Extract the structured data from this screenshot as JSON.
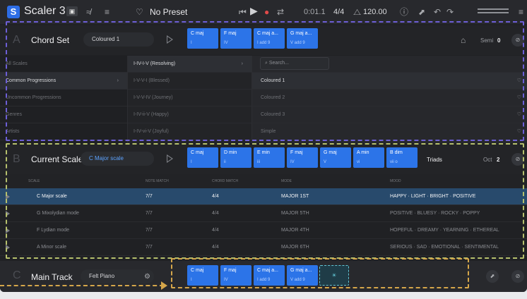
{
  "app": {
    "logo": "S",
    "title": "Scaler 3"
  },
  "topbar": {
    "preset": "No Preset",
    "position": "0:01.1",
    "time_signature": "4/4",
    "tempo": "120.00"
  },
  "chord_set": {
    "letter": "A",
    "title": "Chord Set",
    "set_name": "Coloured 1",
    "chords": [
      {
        "name": "C maj",
        "degree": "I"
      },
      {
        "name": "F maj",
        "degree": "IV"
      },
      {
        "name": "C maj a...",
        "degree": "I add 9"
      },
      {
        "name": "G maj a...",
        "degree": "V add 9"
      }
    ],
    "semi_label": "Semi",
    "semi_value": "0"
  },
  "browser": {
    "categories": [
      "All Scales",
      "Common Progressions",
      "Uncommon Progressions",
      "Genres",
      "Artists"
    ],
    "progressions": [
      "I-IV-I-V (Resolving)",
      "I-V-V-I (Blessed)",
      "I-V-V-IV (Journey)",
      "I-IV-ii-V (Happy)",
      "I-IV-vi-V (Joyful)"
    ],
    "search_placeholder": "Search...",
    "sets": [
      "Coloured 1",
      "Coloured 2",
      "Coloured 3",
      "Simple"
    ]
  },
  "current_scale": {
    "letter": "B",
    "title": "Current Scale",
    "scale_name": "C Major scale",
    "chords": [
      {
        "name": "C maj",
        "degree": "I"
      },
      {
        "name": "D min",
        "degree": "ii"
      },
      {
        "name": "E min",
        "degree": "iii"
      },
      {
        "name": "F maj",
        "degree": "IV"
      },
      {
        "name": "G maj",
        "degree": "V"
      },
      {
        "name": "A min",
        "degree": "vi"
      },
      {
        "name": "B dim",
        "degree": "vii o"
      }
    ],
    "mode": "Triads",
    "oct_label": "Oct",
    "oct_value": "2"
  },
  "scale_table": {
    "headers": [
      "SCALE",
      "NOTE MATCH",
      "CHORD MATCH",
      "MODE",
      "MOOD"
    ],
    "rows": [
      {
        "scale": "C Major scale",
        "note": "7/7",
        "chord": "4/4",
        "mode": "MAJOR 1ST",
        "mood": "HAPPY · LIGHT · BRIGHT · POSITIVE"
      },
      {
        "scale": "G Mixolydian mode",
        "note": "7/7",
        "chord": "4/4",
        "mode": "MAJOR 5TH",
        "mood": "POSITIVE · BLUESY · ROCKY · POPPY"
      },
      {
        "scale": "F Lydian mode",
        "note": "7/7",
        "chord": "4/4",
        "mode": "MAJOR 4TH",
        "mood": "HOPEFUL · DREAMY · YEARNING · ETHEREAL"
      },
      {
        "scale": "A Minor scale",
        "note": "7/7",
        "chord": "4/4",
        "mode": "MAJOR 6TH",
        "mood": "SERIOUS · SAD · EMOTIONAL · SENTIMENTAL"
      }
    ]
  },
  "main_track": {
    "letter": "C",
    "title": "Main Track",
    "instrument": "Felt Piano",
    "chords": [
      {
        "name": "C maj",
        "degree": "I"
      },
      {
        "name": "F maj",
        "degree": "IV"
      },
      {
        "name": "C maj a...",
        "degree": "I add 9"
      },
      {
        "name": "G maj a...",
        "degree": "V add 9"
      }
    ]
  },
  "colors": {
    "accent": "#2c74e8",
    "chord_set_outline": "#6d5fd7",
    "current_scale_outline": "#b6c06d",
    "main_track_outline": "#d5a64a",
    "drop_target": "#63c7d6"
  }
}
